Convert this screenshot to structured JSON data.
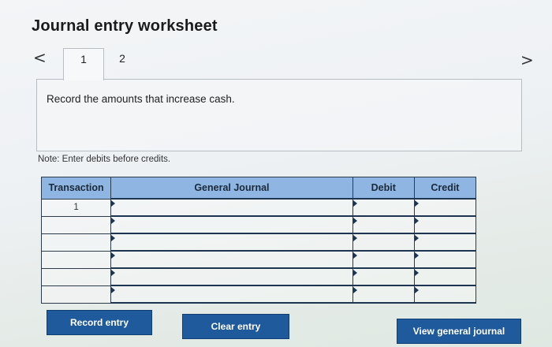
{
  "header": {
    "title": "Journal entry worksheet"
  },
  "nav": {
    "prev_icon": "chevron-left-icon",
    "prev_glyph": "<",
    "next_icon": "chevron-right-icon",
    "next_glyph": ">"
  },
  "tabs": [
    {
      "label": "1",
      "active": true
    },
    {
      "label": "2",
      "active": false
    }
  ],
  "panel": {
    "instruction": "Record the amounts that increase cash."
  },
  "note": "Note: Enter debits before credits.",
  "table": {
    "headers": {
      "transaction": "Transaction",
      "general_journal": "General Journal",
      "debit": "Debit",
      "credit": "Credit"
    },
    "rows": [
      {
        "transaction": "1",
        "account": "",
        "debit": "",
        "credit": ""
      },
      {
        "transaction": "",
        "account": "",
        "debit": "",
        "credit": ""
      },
      {
        "transaction": "",
        "account": "",
        "debit": "",
        "credit": ""
      },
      {
        "transaction": "",
        "account": "",
        "debit": "",
        "credit": ""
      },
      {
        "transaction": "",
        "account": "",
        "debit": "",
        "credit": ""
      },
      {
        "transaction": "",
        "account": "",
        "debit": "",
        "credit": ""
      }
    ]
  },
  "buttons": {
    "record": "Record entry",
    "clear": "Clear entry",
    "view": "View general journal"
  },
  "colors": {
    "header_bg": "#8fb6e2",
    "button_bg": "#1f5a9c"
  }
}
